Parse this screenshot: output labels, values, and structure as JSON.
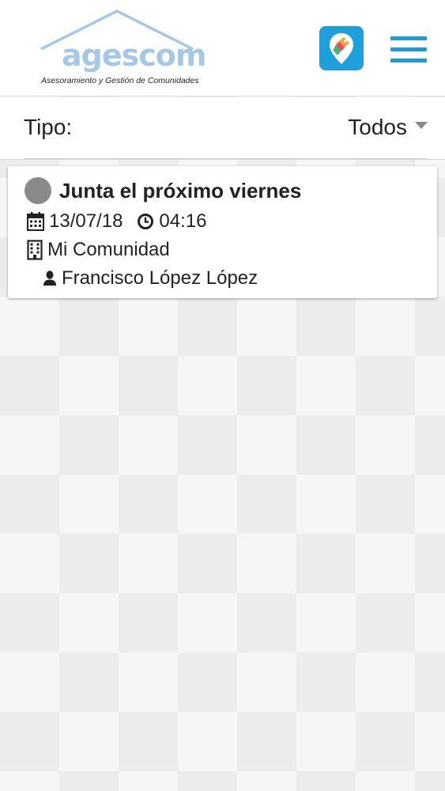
{
  "header": {
    "logo_word": "agescom",
    "logo_subtitle": "Asesoramiento y Gestión de Comunidades",
    "brand_color": "#a7c7e6",
    "accent_color": "#1e9bd7",
    "app_badge_icon": "map-pin-tag-icon",
    "menu_icon": "hamburger-menu-icon"
  },
  "filter": {
    "label": "Tipo:",
    "selected": "Todos"
  },
  "events": [
    {
      "title": "Junta el próximo viernes",
      "status_color": "#8a8a8a",
      "date": "13/07/18",
      "time": "04:16",
      "community": "Mi Comunidad",
      "person": "Francisco López López"
    }
  ]
}
